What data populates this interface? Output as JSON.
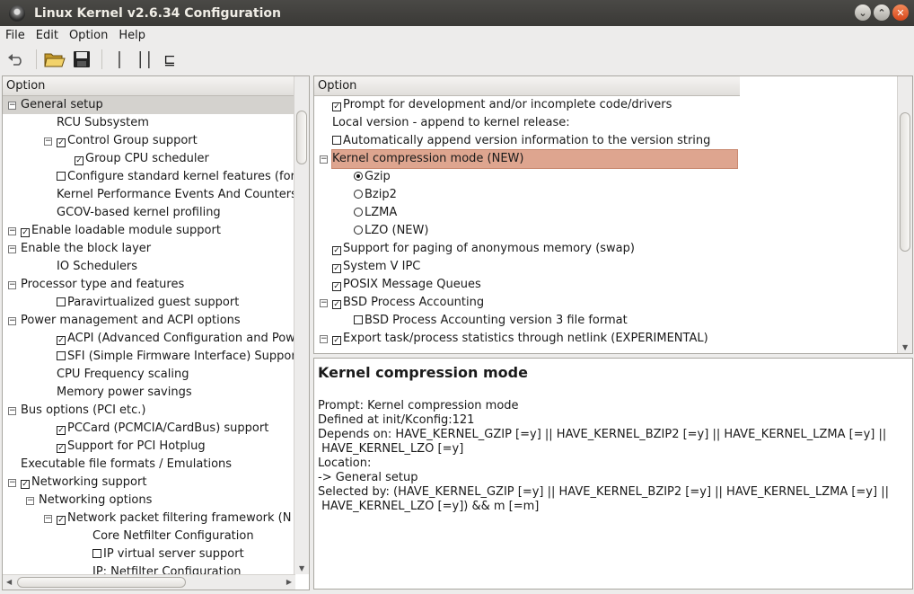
{
  "window": {
    "title": "Linux Kernel v2.6.34 Configuration"
  },
  "menu": [
    "File",
    "Edit",
    "Option",
    "Help"
  ],
  "left": {
    "header": "Option",
    "rows": [
      {
        "label": "General setup",
        "indent": 0,
        "exp": "-",
        "cb": null,
        "selected": true
      },
      {
        "label": "RCU Subsystem",
        "indent": 2,
        "exp": null,
        "cb": null
      },
      {
        "label": "Control Group support",
        "indent": 2,
        "exp": "-",
        "cb": "checked"
      },
      {
        "label": "Group CPU scheduler",
        "indent": 3,
        "exp": null,
        "cb": "checked"
      },
      {
        "label": "Configure standard kernel features (for sm",
        "indent": 2,
        "exp": null,
        "cb": "unchecked"
      },
      {
        "label": "Kernel Performance Events And Counters",
        "indent": 2,
        "exp": null,
        "cb": null
      },
      {
        "label": "GCOV-based kernel profiling",
        "indent": 2,
        "exp": null,
        "cb": null
      },
      {
        "label": "Enable loadable module support",
        "indent": 0,
        "exp": "-",
        "cb": "checked"
      },
      {
        "label": "Enable the block layer",
        "indent": 0,
        "exp": "-",
        "cb": null
      },
      {
        "label": "IO Schedulers",
        "indent": 2,
        "exp": null,
        "cb": null
      },
      {
        "label": "Processor type and features",
        "indent": 0,
        "exp": "-",
        "cb": null
      },
      {
        "label": "Paravirtualized guest support",
        "indent": 2,
        "exp": null,
        "cb": "unchecked"
      },
      {
        "label": "Power management and ACPI options",
        "indent": 0,
        "exp": "-",
        "cb": null
      },
      {
        "label": "ACPI (Advanced Configuration and Power",
        "indent": 2,
        "exp": null,
        "cb": "checked"
      },
      {
        "label": "SFI (Simple Firmware Interface) Support (",
        "indent": 2,
        "exp": null,
        "cb": "unchecked"
      },
      {
        "label": "CPU Frequency scaling",
        "indent": 2,
        "exp": null,
        "cb": null
      },
      {
        "label": "Memory power savings",
        "indent": 2,
        "exp": null,
        "cb": null
      },
      {
        "label": "Bus options (PCI etc.)",
        "indent": 0,
        "exp": "-",
        "cb": null
      },
      {
        "label": "PCCard (PCMCIA/CardBus) support",
        "indent": 2,
        "exp": null,
        "cb": "checked"
      },
      {
        "label": "Support for PCI Hotplug",
        "indent": 2,
        "exp": null,
        "cb": "checked"
      },
      {
        "label": "Executable file formats / Emulations",
        "indent": 0,
        "exp": null,
        "cb": null
      },
      {
        "label": "Networking support",
        "indent": 0,
        "exp": "-",
        "cb": "checked"
      },
      {
        "label": "Networking options",
        "indent": 1,
        "exp": "-",
        "cb": null
      },
      {
        "label": "Network packet filtering framework (N",
        "indent": 2,
        "exp": "-",
        "cb": "checked"
      },
      {
        "label": "Core Netfilter Configuration",
        "indent": 4,
        "exp": null,
        "cb": null
      },
      {
        "label": "IP virtual server support",
        "indent": 4,
        "exp": null,
        "cb": "unchecked"
      },
      {
        "label": "IP: Netfilter Configuration",
        "indent": 4,
        "exp": null,
        "cb": null
      }
    ]
  },
  "right": {
    "header": "Option",
    "rows": [
      {
        "label": "Prompt for development and/or incomplete code/drivers",
        "indent": 0,
        "exp": null,
        "cb": "checked"
      },
      {
        "label": "Local version - append to kernel release:",
        "indent": 0,
        "exp": null,
        "cb": null
      },
      {
        "label": "Automatically append version information to the version string",
        "indent": 0,
        "exp": null,
        "cb": "unchecked"
      },
      {
        "label": "Kernel compression mode (NEW)",
        "indent": 0,
        "exp": "-",
        "cb": null,
        "highlight": true
      },
      {
        "label": "Gzip",
        "indent": 2,
        "exp": null,
        "rb": "on"
      },
      {
        "label": "Bzip2",
        "indent": 2,
        "exp": null,
        "rb": "off"
      },
      {
        "label": "LZMA",
        "indent": 2,
        "exp": null,
        "rb": "off"
      },
      {
        "label": "LZO (NEW)",
        "indent": 2,
        "exp": null,
        "rb": "off"
      },
      {
        "label": "Support for paging of anonymous memory (swap)",
        "indent": 0,
        "exp": null,
        "cb": "checked"
      },
      {
        "label": "System V IPC",
        "indent": 0,
        "exp": null,
        "cb": "checked"
      },
      {
        "label": "POSIX Message Queues",
        "indent": 0,
        "exp": null,
        "cb": "checked"
      },
      {
        "label": "BSD Process Accounting",
        "indent": 0,
        "exp": "-",
        "cb": "checked"
      },
      {
        "label": "BSD Process Accounting version 3 file format",
        "indent": 2,
        "exp": null,
        "cb": "unchecked"
      },
      {
        "label": "Export task/process statistics through netlink (EXPERIMENTAL)",
        "indent": 0,
        "exp": "-",
        "cb": "checked"
      }
    ]
  },
  "info": {
    "title": "Kernel compression mode",
    "lines": [
      "Prompt: Kernel compression mode",
      "Defined at init/Kconfig:121",
      "Depends on: HAVE_KERNEL_GZIP [=y] || HAVE_KERNEL_BZIP2 [=y] || HAVE_KERNEL_LZMA [=y] ||",
      " HAVE_KERNEL_LZO [=y]",
      "Location:",
      "-> General setup",
      "Selected by: (HAVE_KERNEL_GZIP [=y] || HAVE_KERNEL_BZIP2 [=y] || HAVE_KERNEL_LZMA [=y] ||",
      " HAVE_KERNEL_LZO [=y]) && m [=m]"
    ]
  },
  "colors": {
    "titlebar": "#3c3b37",
    "selection": "#d4d2ce",
    "highlight": "#dea58f"
  }
}
